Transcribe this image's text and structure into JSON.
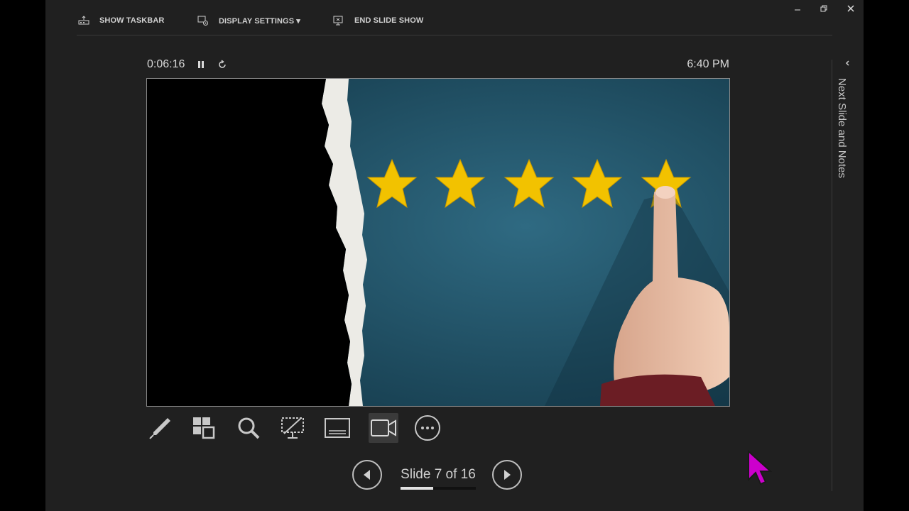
{
  "toolbar": {
    "show_taskbar": "SHOW TASKBAR",
    "display_settings": "DISPLAY SETTINGS ▾",
    "end_slide_show": "END SLIDE SHOW"
  },
  "window_controls": [
    "minimize-icon",
    "restore-icon",
    "close-icon"
  ],
  "presenter": {
    "elapsed_time": "0:06:16",
    "clock": "6:40 PM",
    "side_panel_label": "Next Slide and Notes"
  },
  "slide": {
    "star_count": 5,
    "colors": {
      "background": "#1e4a5e",
      "stars": "#f2c200",
      "left_panel": "#000000"
    }
  },
  "tools": [
    "pen-icon",
    "slides-grid-icon",
    "zoom-icon",
    "black-screen-icon",
    "subtitles-icon",
    "camera-icon",
    "more-options-icon"
  ],
  "navigation": {
    "slide_label": "Slide 7 of 16",
    "current": 7,
    "total": 16,
    "progress_fraction": 0.4375
  },
  "colors": {
    "background": "#202020",
    "cursor": "#cc00cc"
  }
}
